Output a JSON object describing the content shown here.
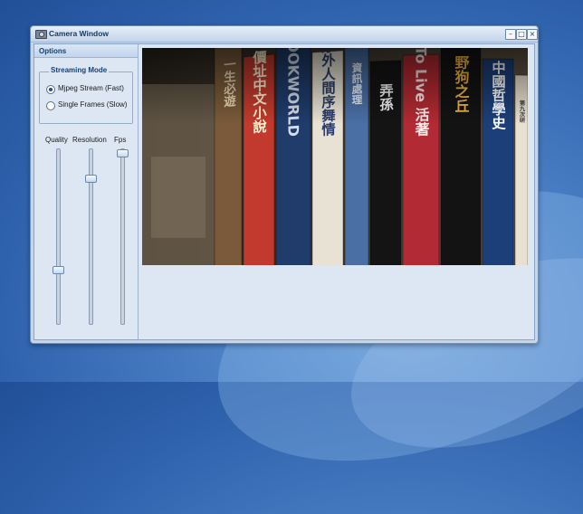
{
  "window": {
    "title": "Camera Window",
    "icon": "camera-icon",
    "controls": {
      "minimize": "–",
      "maximize": "□",
      "close": "×"
    }
  },
  "options": {
    "header": "Options",
    "streaming_mode": {
      "legend": "Streaming Mode",
      "choices": [
        {
          "label": "Mjpeg Stream (Fast)",
          "selected": true
        },
        {
          "label": "Single Frames (Slow)",
          "selected": false
        }
      ]
    },
    "sliders": [
      {
        "label": "Quality",
        "level": 0.3
      },
      {
        "label": "Resolution",
        "level": 0.85
      },
      {
        "label": "Fps",
        "level": 1.0
      }
    ]
  },
  "feed": {
    "book_spines": [
      {
        "text": "一生必遊",
        "color": "#7a5a3a",
        "textColor": "#e8d8b0"
      },
      {
        "text": "價址中文小說",
        "color": "#c23a2e",
        "textColor": "#fff2d0"
      },
      {
        "text": "BOOKWORLD",
        "color": "#1f3c6b",
        "textColor": "#d6dde9"
      },
      {
        "text": "序外人間序舞情",
        "color": "#e7e2d4",
        "textColor": "#2b3f6e"
      },
      {
        "text": "資訊處理",
        "color": "#4a6fa5",
        "textColor": "#e6eefb"
      },
      {
        "text": "弄孫",
        "color": "#141414",
        "textColor": "#f2f2f2"
      },
      {
        "text": "To Live 活著",
        "color": "#b22a33",
        "textColor": "#fbe9e9"
      },
      {
        "text": "野狗之丘",
        "color": "#131313",
        "textColor": "#f2b63a"
      },
      {
        "text": "中國哲學史",
        "color": "#1c3f7a",
        "textColor": "#ffffff"
      },
      {
        "text": "第九次研",
        "color": "#e8e1cf",
        "textColor": "#3b3b3b"
      }
    ]
  }
}
